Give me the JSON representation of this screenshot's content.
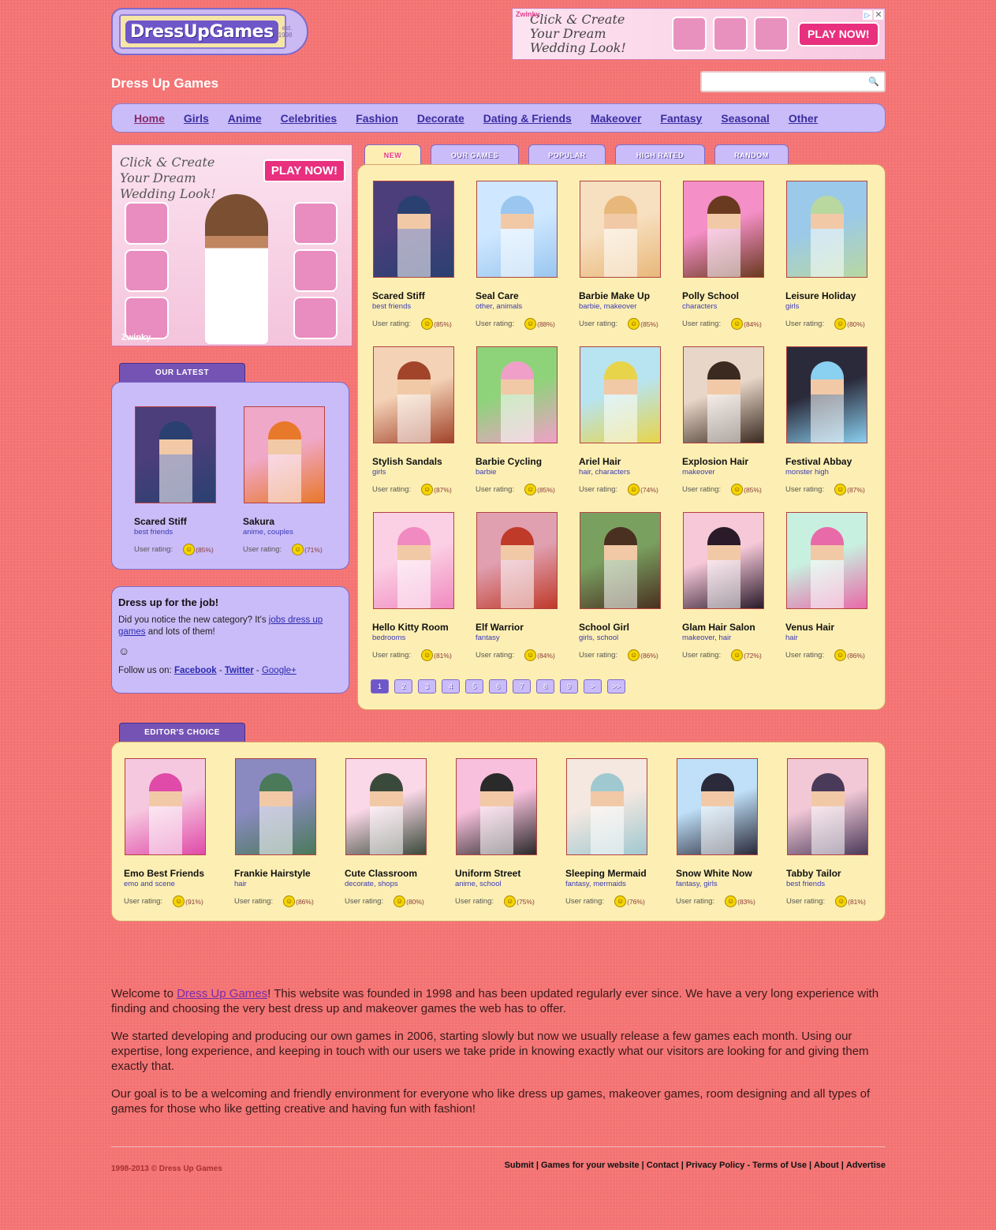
{
  "header": {
    "logo_text": "DressUpGames",
    "logo_est": "est. 1998",
    "site_title": "Dress Up Games",
    "search_placeholder": ""
  },
  "top_ad": {
    "brand": "Zwinky",
    "slogan": "Click & Create Your Dream Wedding Look!",
    "button": "PLAY NOW!",
    "close": "✕",
    "info": "▷"
  },
  "nav": [
    {
      "label": "Home",
      "active": true
    },
    {
      "label": "Girls"
    },
    {
      "label": "Anime"
    },
    {
      "label": "Celebrities"
    },
    {
      "label": "Fashion"
    },
    {
      "label": "Decorate"
    },
    {
      "label": "Dating & Friends"
    },
    {
      "label": "Makeover"
    },
    {
      "label": "Fantasy"
    },
    {
      "label": "Seasonal"
    },
    {
      "label": "Other"
    }
  ],
  "side_ad": {
    "slogan": "Click & Create Your Dream Wedding Look!",
    "button": "PLAY NOW!",
    "brand": "Zwinky"
  },
  "latest": {
    "tab": "Our Latest",
    "items": [
      {
        "title": "Scared Stiff",
        "tags": "best friends",
        "rating": "(85%)"
      },
      {
        "title": "Sakura",
        "tags": "anime, couples",
        "rating": "(71%)"
      }
    ]
  },
  "job": {
    "heading": "Dress up for the job!",
    "text_before": "Did you notice the new category? It's ",
    "link": "jobs dress up games",
    "text_after": " and lots of them!",
    "follow": "Follow us on: ",
    "facebook": "Facebook",
    "twitter": "Twitter",
    "google": "Google+"
  },
  "tabs": [
    "New",
    "Our Games",
    "Popular",
    "High Rated",
    "Random"
  ],
  "rating_label": "User rating:",
  "games": [
    {
      "title": "Scared Stiff",
      "tags": "best friends",
      "rating": "(85%)",
      "colors": [
        "#4b3e7a",
        "#2a4070"
      ]
    },
    {
      "title": "Seal Care",
      "tags": "other, animals",
      "rating": "(88%)",
      "colors": [
        "#cfe8ff",
        "#9ac6f0"
      ]
    },
    {
      "title": "Barbie Make Up",
      "tags": "barbie, makeover",
      "rating": "(85%)",
      "colors": [
        "#f7e0c0",
        "#e8b87a"
      ]
    },
    {
      "title": "Polly School",
      "tags": "characters",
      "rating": "(84%)",
      "colors": [
        "#f58fc7",
        "#6a3a20"
      ]
    },
    {
      "title": "Leisure Holiday",
      "tags": "girls",
      "rating": "(80%)",
      "colors": [
        "#9ac9ea",
        "#b8d8a0"
      ]
    },
    {
      "title": "Stylish Sandals",
      "tags": "girls",
      "rating": "(87%)",
      "colors": [
        "#f4d2b6",
        "#a2442a"
      ]
    },
    {
      "title": "Barbie Cycling",
      "tags": "barbie",
      "rating": "(85%)",
      "colors": [
        "#8ed37a",
        "#f0a0c8"
      ]
    },
    {
      "title": "Ariel Hair",
      "tags": "hair, characters",
      "rating": "(74%)",
      "colors": [
        "#b7e4f0",
        "#e8d44a"
      ]
    },
    {
      "title": "Explosion Hair",
      "tags": "makeover",
      "rating": "(85%)",
      "colors": [
        "#e8d6c8",
        "#3a2a20"
      ]
    },
    {
      "title": "Festival Abbay",
      "tags": "monster high",
      "rating": "(87%)",
      "colors": [
        "#2a2a3a",
        "#8ad0f0"
      ]
    },
    {
      "title": "Hello Kitty Room",
      "tags": "bedrooms",
      "rating": "(81%)",
      "colors": [
        "#fbd0e4",
        "#f08ac0"
      ]
    },
    {
      "title": "Elf Warrior",
      "tags": "fantasy",
      "rating": "(84%)",
      "colors": [
        "#e0a0b0",
        "#c03a2a"
      ]
    },
    {
      "title": "School Girl",
      "tags": "girls, school",
      "rating": "(86%)",
      "colors": [
        "#7aa060",
        "#4a3020"
      ]
    },
    {
      "title": "Glam Hair Salon",
      "tags": "makeover, hair",
      "rating": "(72%)",
      "colors": [
        "#f6c8d8",
        "#2a1a2a"
      ]
    },
    {
      "title": "Venus Hair",
      "tags": "hair",
      "rating": "(86%)",
      "colors": [
        "#c8f0e0",
        "#e86aa8"
      ]
    }
  ],
  "pagination": [
    "1",
    "2",
    "3",
    "4",
    "5",
    "6",
    "7",
    "8",
    "9",
    ">",
    ">>"
  ],
  "editor": {
    "tab": "Editor's Choice",
    "items": [
      {
        "title": "Emo Best Friends",
        "tags": "emo and scene",
        "rating": "(91%)",
        "colors": [
          "#f6c8e0",
          "#e04aa8"
        ]
      },
      {
        "title": "Frankie Hairstyle",
        "tags": "hair",
        "rating": "(86%)",
        "colors": [
          "#8a8ac0",
          "#4a7a5a"
        ]
      },
      {
        "title": "Cute Classroom",
        "tags": "decorate, shops",
        "rating": "(80%)",
        "colors": [
          "#fbd8e8",
          "#3a4a3a"
        ]
      },
      {
        "title": "Uniform Street",
        "tags": "anime, school",
        "rating": "(75%)",
        "colors": [
          "#f8c0dc",
          "#2a2a2a"
        ]
      },
      {
        "title": "Sleeping Mermaid",
        "tags": "fantasy, mermaids",
        "rating": "(76%)",
        "colors": [
          "#f4e8e0",
          "#a0c8d0"
        ]
      },
      {
        "title": "Snow White Now",
        "tags": "fantasy, girls",
        "rating": "(83%)",
        "colors": [
          "#bfe0f8",
          "#2a2a3a"
        ]
      },
      {
        "title": "Tabby Tailor",
        "tags": "best friends",
        "rating": "(81%)",
        "colors": [
          "#f2c8d6",
          "#4a3a5a"
        ]
      }
    ]
  },
  "welcome": {
    "p1_before": "Welcome to ",
    "p1_link": "Dress Up Games",
    "p1_after": "! This website was founded in 1998 and has been updated regularly ever since. We have a very long experience with finding and choosing the very best dress up and makeover games the web has to offer.",
    "p2": "We started developing and producing our own games in 2006, starting slowly but now we usually release a few games each month. Using our expertise, long experience, and keeping in touch with our users we take pride in knowing exactly what our visitors are looking for and giving them exactly that.",
    "p3": "Our goal is to be a welcoming and friendly environment for everyone who like dress up games, makeover games, room designing and all types of games for those who like getting creative and having fun with fashion!"
  },
  "footer": {
    "copyright": "1998-2013 © Dress Up Games",
    "links": [
      "Submit",
      "Games for your website",
      "Contact",
      "Privacy Policy",
      "Terms of Use",
      "About",
      "Advertise"
    ]
  }
}
